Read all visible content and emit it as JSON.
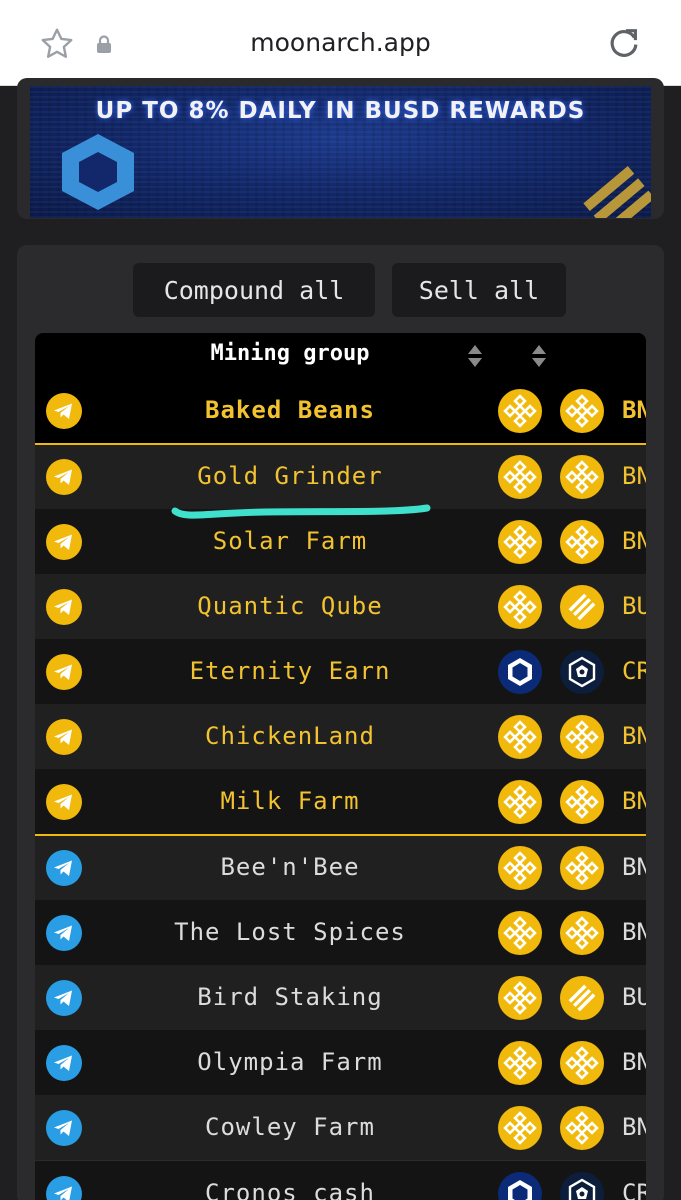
{
  "browser": {
    "url": "moonarch.app"
  },
  "banner": {
    "text": "UP TO 8% DAILY IN BUSD REWARDS"
  },
  "actions": {
    "compound_label": "Compound all",
    "sell_label": "Sell all"
  },
  "table": {
    "header": "Mining group",
    "rows": [
      {
        "name": "Baked Beans",
        "token": "BN",
        "group": "pinned",
        "coins": [
          "bnb",
          "bnb"
        ]
      },
      {
        "name": "Gold Grinder",
        "token": "BN",
        "group": "pinned",
        "coins": [
          "bnb",
          "bnb"
        ]
      },
      {
        "name": "Solar Farm",
        "token": "BN",
        "group": "pinned",
        "coins": [
          "bnb",
          "bnb"
        ]
      },
      {
        "name": "Quantic Qube",
        "token": "BU",
        "group": "pinned",
        "coins": [
          "bnb",
          "busd"
        ]
      },
      {
        "name": "Eternity Earn",
        "token": "CR",
        "group": "pinned",
        "coins": [
          "cronos",
          "cro"
        ]
      },
      {
        "name": "ChickenLand",
        "token": "BN",
        "group": "pinned",
        "coins": [
          "bnb",
          "bnb"
        ]
      },
      {
        "name": "Milk Farm",
        "token": "BN",
        "group": "pinned",
        "coins": [
          "bnb",
          "bnb"
        ]
      },
      {
        "name": "Bee'n'Bee",
        "token": "BN",
        "group": "other",
        "coins": [
          "bnb",
          "bnb"
        ]
      },
      {
        "name": "The Lost Spices",
        "token": "BN",
        "group": "other",
        "coins": [
          "bnb",
          "bnb"
        ]
      },
      {
        "name": "Bird Staking",
        "token": "BU",
        "group": "other",
        "coins": [
          "bnb",
          "busd"
        ]
      },
      {
        "name": "Olympia Farm",
        "token": "BN",
        "group": "other",
        "coins": [
          "bnb",
          "bnb"
        ]
      },
      {
        "name": "Cowley Farm",
        "token": "BN",
        "group": "other",
        "coins": [
          "bnb",
          "bnb"
        ]
      },
      {
        "name": "Cronos cash",
        "token": "CR",
        "group": "other",
        "coins": [
          "cronos",
          "cro"
        ]
      }
    ]
  },
  "colors": {
    "gold": "#f0b90b",
    "gold_text": "#f2c230",
    "telegram_blue": "#2a9ee4",
    "row_dark": "#141414",
    "row_light": "#202020",
    "highlight_line": "#3fe0cc"
  },
  "icons": [
    "star-icon",
    "lock-icon",
    "reload-icon",
    "telegram-icon",
    "bnb-icon",
    "busd-icon",
    "cronos-icon",
    "cro-icon",
    "sort-icon"
  ]
}
